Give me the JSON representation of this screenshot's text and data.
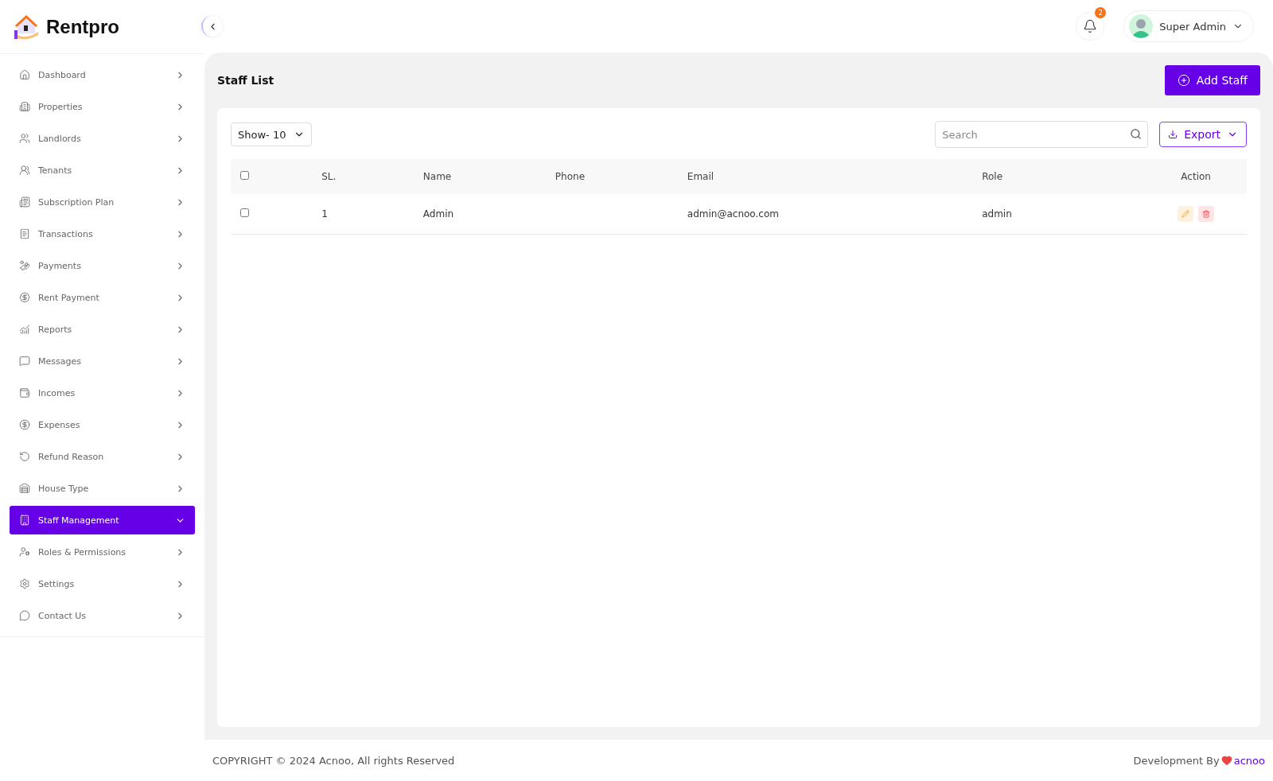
{
  "brand": "Rentpro",
  "sidebar": {
    "items": [
      {
        "label": "Dashboard",
        "selected": false
      },
      {
        "label": "Properties",
        "selected": false
      },
      {
        "label": "Landlords",
        "selected": false
      },
      {
        "label": "Tenants",
        "selected": false
      },
      {
        "label": "Subscription Plan",
        "selected": false
      },
      {
        "label": "Transactions",
        "selected": false
      },
      {
        "label": "Payments",
        "selected": false
      },
      {
        "label": "Rent Payment",
        "selected": false
      },
      {
        "label": "Reports",
        "selected": false
      },
      {
        "label": "Messages",
        "selected": false
      },
      {
        "label": "Incomes",
        "selected": false
      },
      {
        "label": "Expenses",
        "selected": false
      },
      {
        "label": "Refund Reason",
        "selected": false
      },
      {
        "label": "House Type",
        "selected": false
      },
      {
        "label": "Staff Management",
        "selected": true
      },
      {
        "label": "Roles & Permissions",
        "selected": false
      },
      {
        "label": "Settings",
        "selected": false
      },
      {
        "label": "Contact Us",
        "selected": false
      }
    ]
  },
  "header": {
    "notification_count": "2",
    "user": "Super Admin"
  },
  "page": {
    "title": "Staff List",
    "add_button": "Add Staff"
  },
  "toolbar": {
    "show": "Show- 10",
    "search": {
      "placeholder": "Search"
    },
    "export": "Export"
  },
  "table": {
    "columns": [
      "SL.",
      "Name",
      "Phone",
      "Email",
      "Role",
      "Action"
    ],
    "header_checked": false,
    "rows": [
      {
        "checked": false,
        "sl": "1",
        "name": "Admin",
        "phone": "",
        "email": "admin@acnoo.com",
        "role": "admin"
      }
    ]
  },
  "footer": {
    "copyright": "COPYRIGHT © 2024 Acnoo, All rights Reserved",
    "dev": "Development By",
    "dev_link": "acnoo"
  }
}
